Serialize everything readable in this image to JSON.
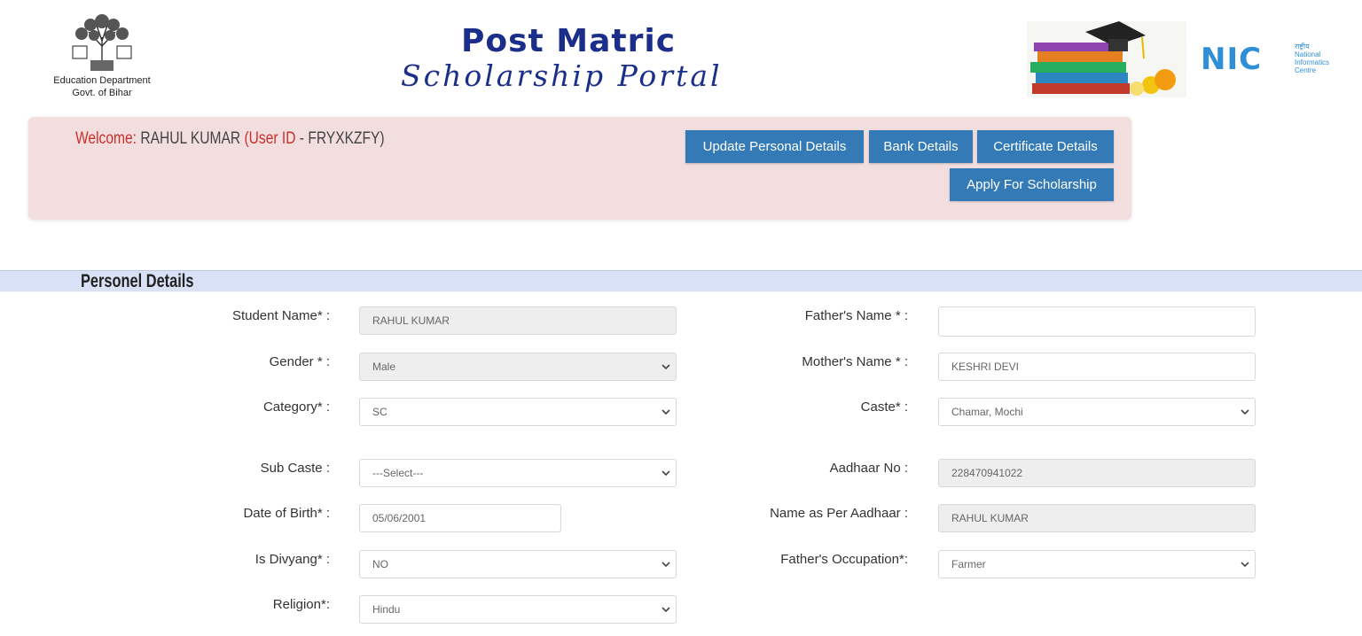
{
  "header": {
    "dept_line1": "Education Department",
    "dept_line2": "Govt. of Bihar",
    "portal_title_line1": "Post Matric",
    "portal_title_line2": "Scholarship Portal",
    "nic_letters": "NIC",
    "nic_hindi": "राष्ट्रीय",
    "nic_line1": "National",
    "nic_line2": "Informatics",
    "nic_line3": "Centre"
  },
  "welcome": {
    "prefix": "Welcome:",
    "user_name": "RAHUL KUMAR",
    "userid_open": "(User ID",
    "userid_value": " - FRYXKZFY)"
  },
  "nav_buttons": {
    "update_personal": "Update Personal Details",
    "bank": "Bank Details",
    "certificate": "Certificate Details",
    "apply": "Apply For Scholarship"
  },
  "section": {
    "title": "Personel Details"
  },
  "form": {
    "student_name": {
      "label": "Student Name* :",
      "value": "RAHUL KUMAR"
    },
    "father_name": {
      "label": "Father's Name * :",
      "value": ""
    },
    "gender": {
      "label": "Gender * :",
      "value": "Male"
    },
    "mother_name": {
      "label": "Mother's Name * :",
      "value": "KESHRI DEVI"
    },
    "category": {
      "label": "Category* :",
      "value": "SC"
    },
    "caste": {
      "label": "Caste* :",
      "value": "Chamar, Mochi"
    },
    "sub_caste": {
      "label": "Sub Caste :",
      "value": "---Select---"
    },
    "aadhaar_no": {
      "label": "Aadhaar No :",
      "value": "228470941022"
    },
    "dob": {
      "label": "Date of Birth* :",
      "value": "05/06/2001"
    },
    "name_as_aadhaar": {
      "label": "Name as Per Aadhaar :",
      "value": "RAHUL KUMAR"
    },
    "divyang": {
      "label": "Is Divyang* :",
      "value": "NO"
    },
    "father_occupation": {
      "label": "Father's Occupation*:",
      "value": "Farmer"
    },
    "religion": {
      "label": "Religion*:",
      "value": "Hindu"
    }
  },
  "colors": {
    "primary_button": "#337ab7",
    "welcome_panel": "#f2dede",
    "section_bar": "#d9e1f7",
    "title_blue": "#1a2e8a",
    "welcome_red": "#c9302c"
  }
}
